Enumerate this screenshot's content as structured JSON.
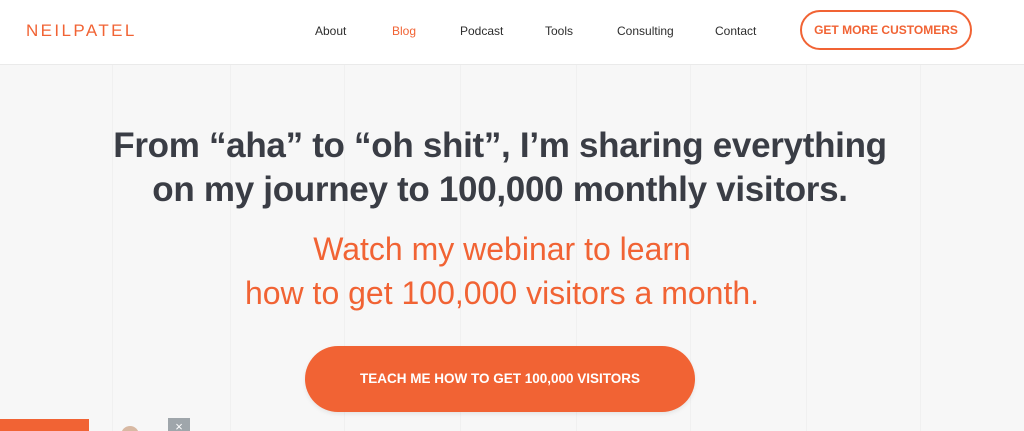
{
  "brand": {
    "logo_text": "NEILPATEL",
    "accent_color": "#f16334",
    "text_color": "#3a3d45"
  },
  "nav": {
    "items": [
      {
        "label": "About",
        "active": false
      },
      {
        "label": "Blog",
        "active": true
      },
      {
        "label": "Podcast",
        "active": false
      },
      {
        "label": "Tools",
        "active": false
      },
      {
        "label": "Consulting",
        "active": false
      },
      {
        "label": "Contact",
        "active": false
      }
    ],
    "cta_label": "GET MORE CUSTOMERS"
  },
  "hero": {
    "headline_line1": "From “aha” to “oh shit”, I’m sharing everything",
    "headline_line2": "on my journey to 100,000 monthly visitors.",
    "subhead_line1": "Watch my webinar to learn",
    "subhead_line2": "how to get 100,000 visitors a month.",
    "cta_label": "TEACH ME HOW TO GET 100,000 VISITORS"
  },
  "popup": {
    "close_icon": "close-icon",
    "close_glyph": "×"
  }
}
